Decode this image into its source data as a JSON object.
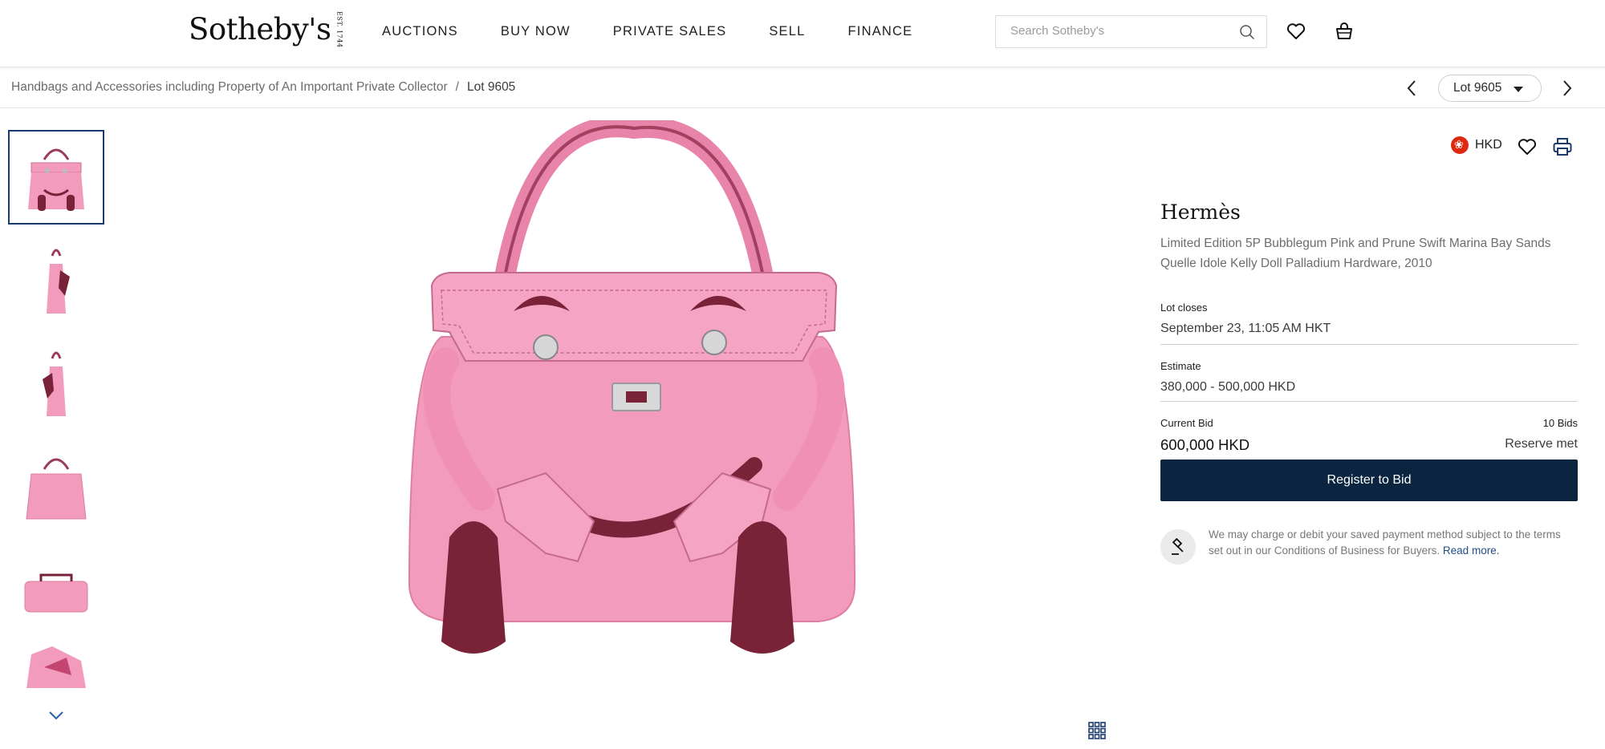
{
  "header": {
    "logo_text": "Sotheby's",
    "logo_est": "EST. 1744",
    "nav": [
      "AUCTIONS",
      "BUY NOW",
      "PRIVATE SALES",
      "SELL",
      "FINANCE"
    ],
    "search_placeholder": "Search Sotheby's"
  },
  "breadcrumb": {
    "sale": "Handbags and Accessories including Property of An Important Private Collector",
    "separator": "/",
    "current": "Lot 9605"
  },
  "lot_selector": {
    "label": "Lot 9605"
  },
  "thumbnails": [
    {
      "view": "front",
      "active": true
    },
    {
      "view": "side-left"
    },
    {
      "view": "side-right"
    },
    {
      "view": "back"
    },
    {
      "view": "bottom"
    },
    {
      "view": "interior"
    }
  ],
  "panel": {
    "currency": "HKD",
    "brand": "Hermès",
    "subtitle": "Limited Edition 5P Bubblegum Pink and Prune Swift Marina Bay Sands Quelle Idole Kelly Doll Palladium Hardware, 2010",
    "lot_closes_label": "Lot closes",
    "lot_closes_value": "September 23, 11:05 AM HKT",
    "estimate_label": "Estimate",
    "estimate_value": "380,000 - 500,000 HKD",
    "current_bid_label": "Current Bid",
    "current_bid_value": "600,000 HKD",
    "bids_count": "10 Bids",
    "reserve_status": "Reserve met",
    "register_button": "Register to Bid",
    "notice_text": "We may charge or debit your saved payment method subject to the terms set out in our Conditions of Business for Buyers.",
    "notice_link": "Read more."
  },
  "colors": {
    "accent": "#0b2540",
    "bag_pink": "#f29bbd",
    "bag_prune": "#7a2238",
    "thumb_active_border": "#1d3a6e",
    "link": "#1f4c8a"
  }
}
